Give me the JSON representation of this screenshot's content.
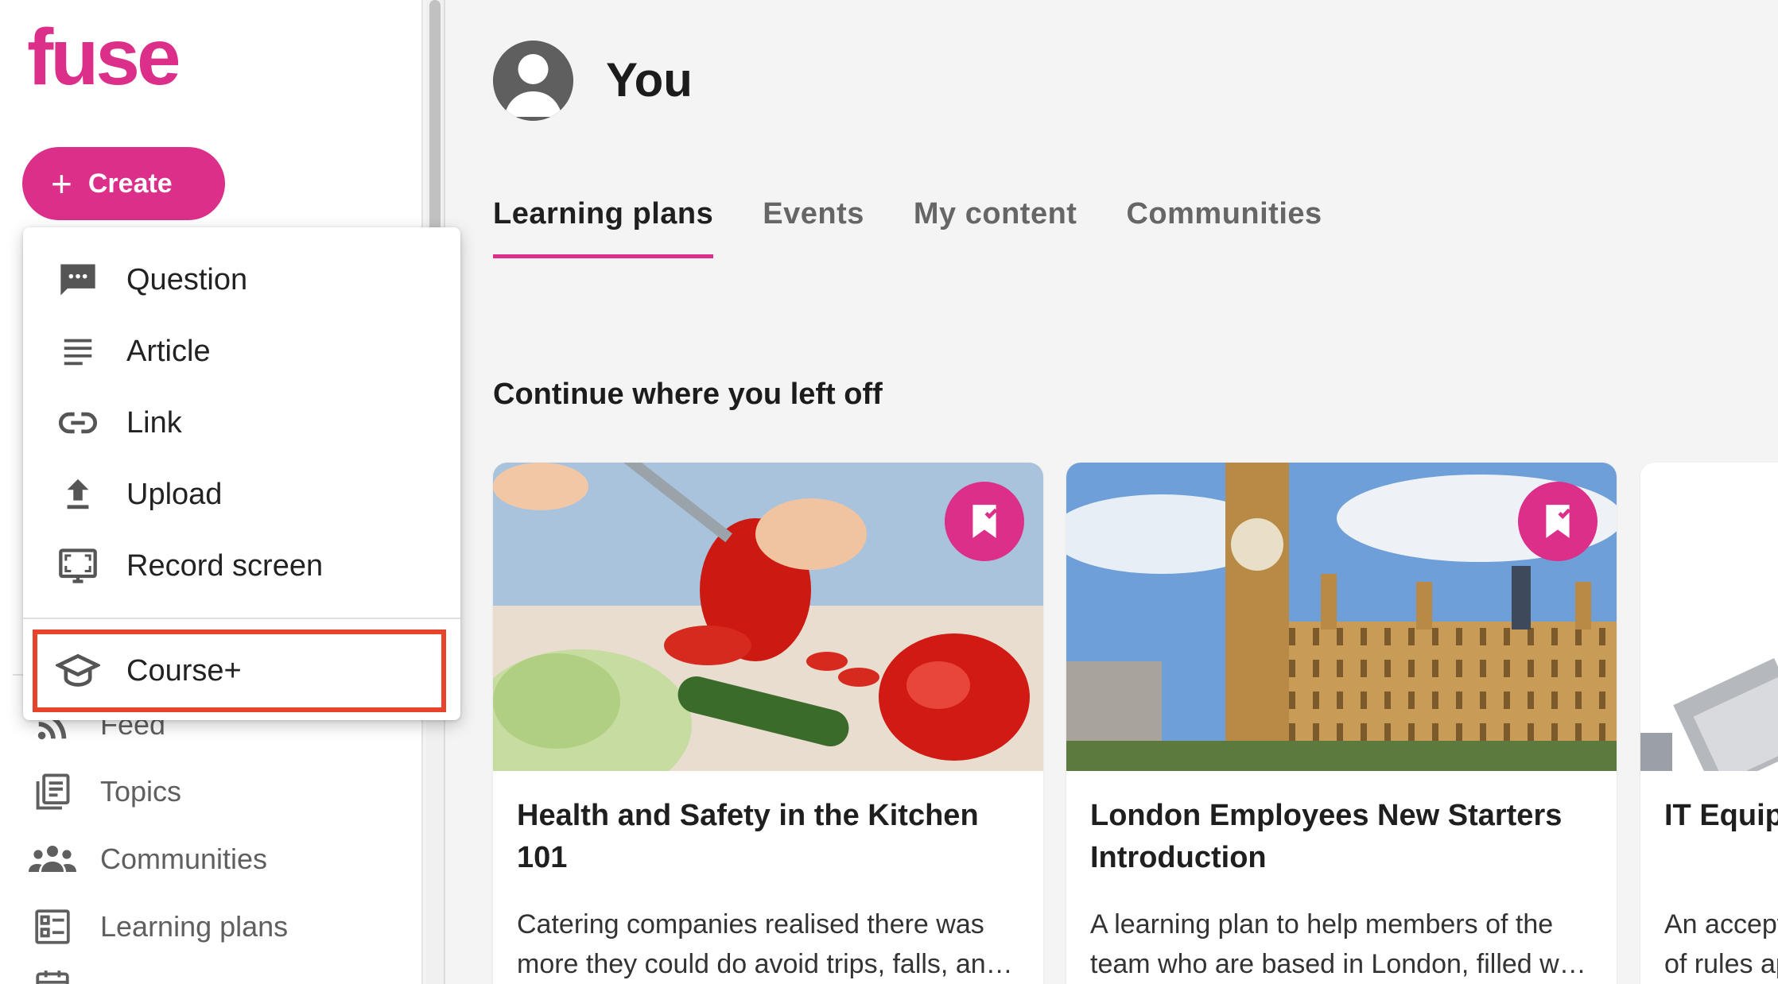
{
  "brand": {
    "logo_text": "fuse",
    "accent": "#db2f8a"
  },
  "create": {
    "label": "Create"
  },
  "create_menu": {
    "items": [
      {
        "label": "Question",
        "icon": "question-bubble-icon"
      },
      {
        "label": "Article",
        "icon": "article-lines-icon"
      },
      {
        "label": "Link",
        "icon": "link-icon"
      },
      {
        "label": "Upload",
        "icon": "upload-icon"
      },
      {
        "label": "Record screen",
        "icon": "record-screen-icon"
      }
    ],
    "course": {
      "label": "Course+",
      "icon": "graduation-cap-icon",
      "highlighted": true
    }
  },
  "sidebar": {
    "items": [
      {
        "label": "Feed",
        "icon": "rss-feed-icon"
      },
      {
        "label": "Topics",
        "icon": "topics-icon"
      },
      {
        "label": "Communities",
        "icon": "communities-icon"
      },
      {
        "label": "Learning plans",
        "icon": "learning-plans-icon"
      }
    ]
  },
  "profile": {
    "title": "You"
  },
  "tabs": [
    {
      "label": "Learning plans",
      "active": true
    },
    {
      "label": "Events",
      "active": false
    },
    {
      "label": "My content",
      "active": false
    },
    {
      "label": "Communities",
      "active": false
    }
  ],
  "section": {
    "title": "Continue where you left off"
  },
  "cards": [
    {
      "title": "Health and Safety in the Kitchen 101",
      "description": "Catering companies realised there was more they could do avoid trips, falls, and other kitchen accidents.",
      "badge_icon": "bookmark-check-icon"
    },
    {
      "title": "London Employees New Starters Introduction",
      "description": "A learning plan to help members of the team who are based in London, filled with useful information.",
      "badge_icon": "bookmark-check-icon"
    },
    {
      "title": "IT Equipment Training",
      "description": "An acceptable use policy (\"AUP\") is a set of rules applied by the owner.",
      "badge_icon": ""
    }
  ]
}
